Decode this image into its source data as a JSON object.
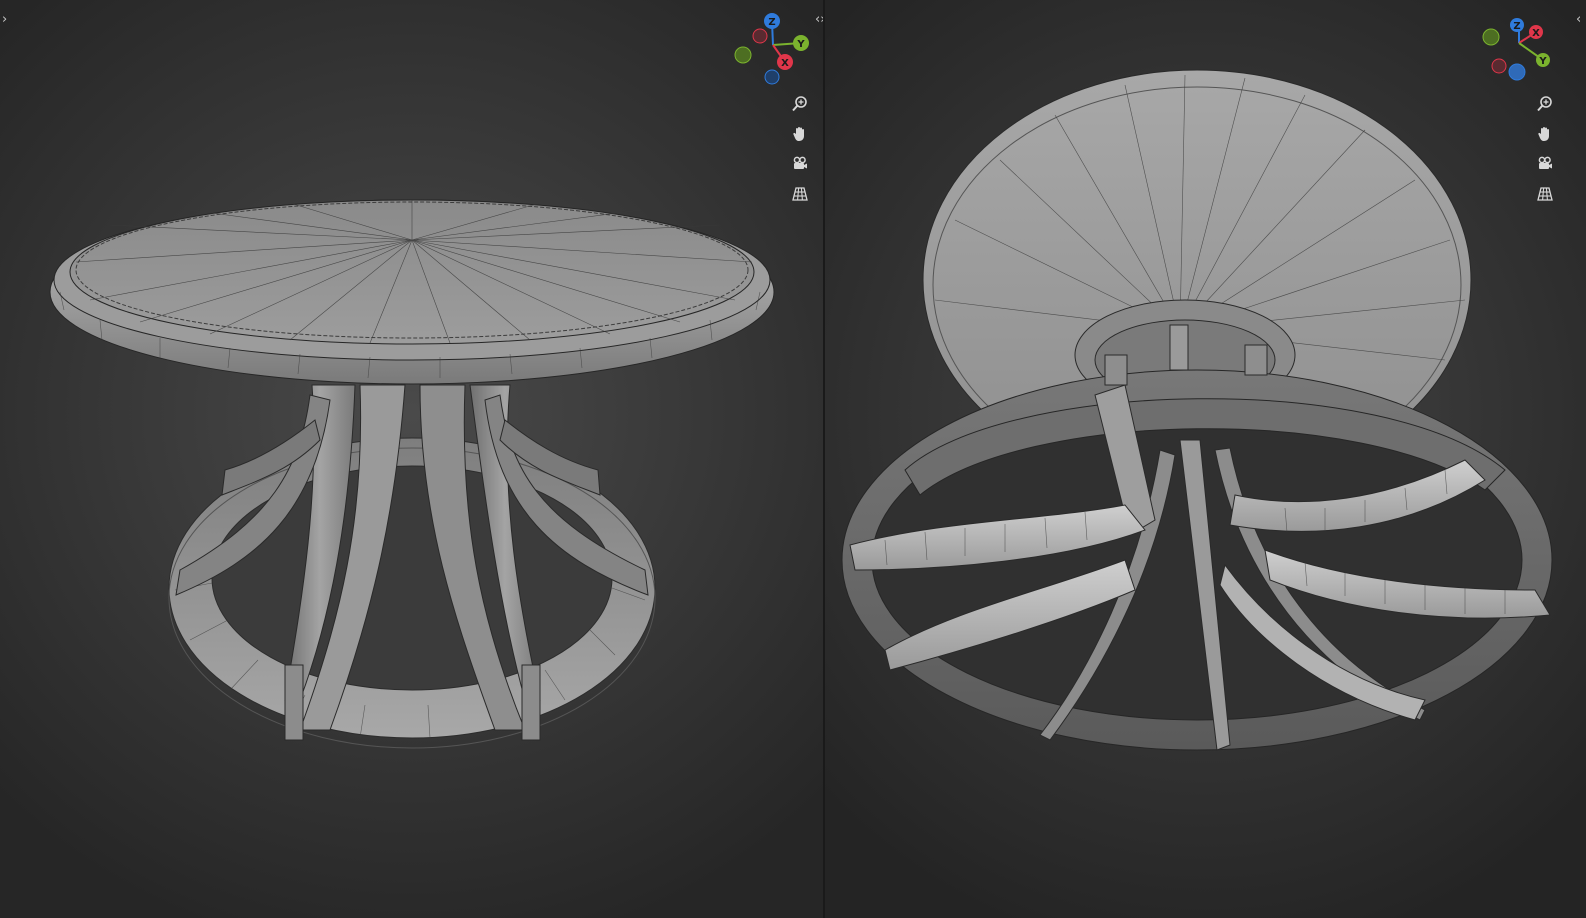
{
  "viewports": {
    "left": {
      "name": "3D Viewport (perspective)",
      "collapse_arrow": "›",
      "split_arrows": "‹›",
      "gizmo": {
        "z": "Z",
        "y": "Y",
        "x": "X"
      },
      "tools": [
        "zoom-icon",
        "hand-pan-icon",
        "camera-icon",
        "perspective-grid-icon"
      ]
    },
    "right": {
      "name": "3D Viewport (from below)",
      "collapse_arrow": "‹",
      "gizmo": {
        "z": "Z",
        "y": "Y",
        "x": "X"
      },
      "tools": [
        "zoom-icon",
        "hand-pan-icon",
        "camera-icon",
        "perspective-grid-icon"
      ]
    }
  },
  "colors": {
    "axis_x": "#e0364a",
    "axis_y": "#7bb32e",
    "axis_z": "#2f7bdc",
    "mesh_light": "#b8b8b8",
    "mesh_dark": "#6a6a6a",
    "wire": "#2a2a2a"
  }
}
